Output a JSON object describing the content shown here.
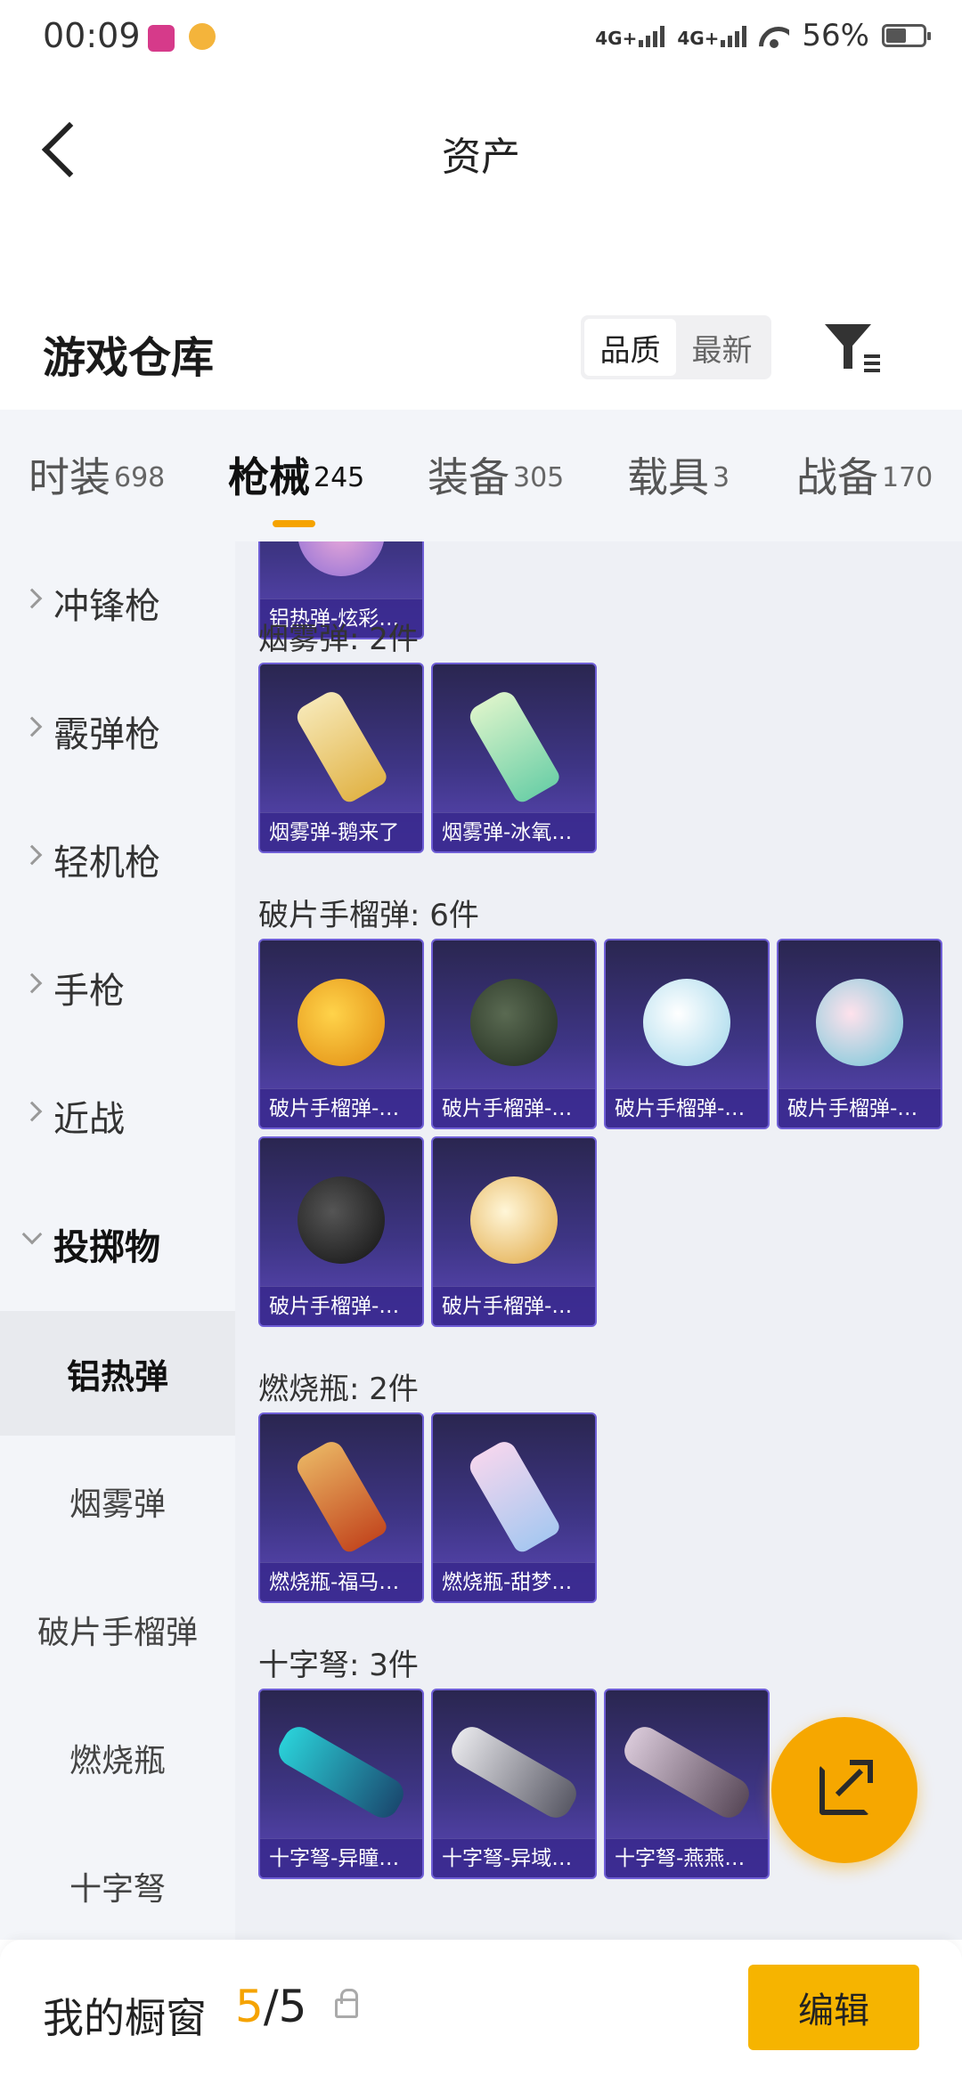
{
  "status_bar": {
    "time": "00:09",
    "signal1": "4G+",
    "signal2": "4G+",
    "battery": "56%"
  },
  "header": {
    "title": "资产"
  },
  "warehouse": {
    "title": "游戏仓库",
    "sort_quality": "品质",
    "sort_newest": "最新"
  },
  "tabs": [
    {
      "label": "时装",
      "count": "698"
    },
    {
      "label": "枪械",
      "count": "245"
    },
    {
      "label": "装备",
      "count": "305"
    },
    {
      "label": "载具",
      "count": "3"
    },
    {
      "label": "战备",
      "count": "170"
    }
  ],
  "sidebar": {
    "categories": [
      "冲锋枪",
      "霰弹枪",
      "轻机枪",
      "手枪",
      "近战",
      "投掷物"
    ],
    "subcategories": [
      "铝热弹",
      "烟雾弹",
      "破片手榴弹",
      "燃烧瓶",
      "十字弩"
    ]
  },
  "sections": [
    {
      "title": "烟雾弹: 2件",
      "items": [
        "烟雾弹-鹅来了",
        "烟雾弹-冰氧…"
      ]
    },
    {
      "title": "破片手榴弹: 6件",
      "items": [
        "破片手榴弹-…",
        "破片手榴弹-…",
        "破片手榴弹-…",
        "破片手榴弹-…",
        "破片手榴弹-…",
        "破片手榴弹-…"
      ]
    },
    {
      "title": "燃烧瓶: 2件",
      "items": [
        "燃烧瓶-福马…",
        "燃烧瓶-甜梦…"
      ]
    },
    {
      "title": "十字弩: 3件",
      "items": [
        "十字弩-异瞳…",
        "十字弩-异域…",
        "十字弩-燕燕…"
      ]
    }
  ],
  "top_item": "铝热弹-炫彩…",
  "showcase": {
    "title": "我的橱窗",
    "current": "5",
    "separator": "/",
    "total": "5",
    "edit_label": "编辑"
  },
  "colors": {
    "accent": "#f5a300",
    "card_border": "#6f5fd6",
    "card_bg": "#3e3585"
  }
}
